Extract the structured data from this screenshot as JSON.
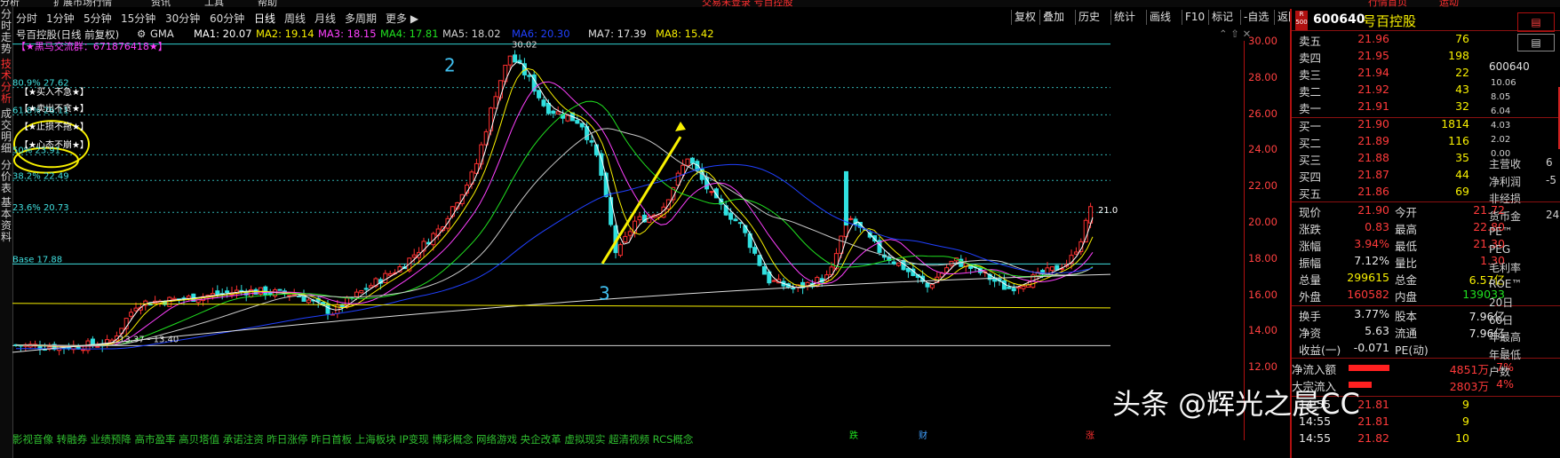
{
  "menu": {
    "items": [
      "分析",
      "扩展市场行情",
      "资讯",
      "工具",
      "帮助"
    ],
    "title_center": "交易未登录 号百控股",
    "right_items": [
      "行情首页",
      "运动"
    ]
  },
  "side_tabs": [
    {
      "label": "分时走势",
      "active": false
    },
    {
      "label": "技术分析",
      "active": true
    },
    {
      "label": "成交明细",
      "active": false
    },
    {
      "label": "分价表",
      "active": false
    },
    {
      "label": "基本资料",
      "active": false
    }
  ],
  "periods": [
    "分时",
    "1分钟",
    "5分钟",
    "15分钟",
    "30分钟",
    "60分钟",
    "日线",
    "周线",
    "月线",
    "多周期",
    "更多 ▶"
  ],
  "active_period": "日线",
  "toolbar": [
    "复权",
    "叠加",
    "历史",
    "统计",
    "画线",
    "F10",
    "标记",
    "-自选",
    "返回"
  ],
  "chart_header": {
    "stock": "号百控股(日线 前复权)",
    "indicator": "GMA"
  },
  "ma_labels": [
    {
      "text": "MA1: 20.07",
      "color": "#ffffff"
    },
    {
      "text": "MA2: 19.14",
      "color": "#f8f000"
    },
    {
      "text": "MA3: 18.15",
      "color": "#ff40ff"
    },
    {
      "text": "MA4: 17.81",
      "color": "#20e020"
    },
    {
      "text": "MA5: 18.02",
      "color": "#d0d0d0"
    },
    {
      "text": "MA6: 20.30",
      "color": "#2040ff"
    },
    {
      "text": "MA7: 17.39",
      "color": "#e0e0e0"
    },
    {
      "text": "MA8: 15.42",
      "color": "#f8f000"
    }
  ],
  "price_ticks": [
    "30.00",
    "28.00",
    "26.00",
    "24.00",
    "22.00",
    "20.00",
    "18.00",
    "16.00",
    "14.00",
    "12.00"
  ],
  "annotations": {
    "group": "【★黑马交流群：671876418★】",
    "fib_80": "80.9% 27.62",
    "fib_618": "61.8% 26.11",
    "fib_50": "50% 23.91",
    "fib_382": "38.2% 22.49",
    "fib_236": "23.6% 20.73",
    "base": "Base 17.88",
    "slogans": [
      "【★买入不急★】",
      "【★卖出不贪★】",
      "【★止损不拖★】",
      "【★心态不崩★】"
    ],
    "peak": "30.02",
    "low": "13.37 - 13.40",
    "wave2": "2",
    "wave3": "3",
    "last_price_tag": "21.0",
    "bottom_ticks": [
      "跌",
      "财",
      "涨"
    ]
  },
  "concepts": "影视音像 转融券 业绩预降 高市盈率 高贝塔值 承诺注资 昨日涨停 昨日首板 上海板块 IP变现 博彩概念 网络游戏 央企改革 虚拟现实 超清视频 RCS概念",
  "quote": {
    "code": "600640",
    "name": "号百控股",
    "badge": "R 500",
    "asks": [
      {
        "label": "卖五",
        "price": "21.96",
        "vol": "76"
      },
      {
        "label": "卖四",
        "price": "21.95",
        "vol": "198"
      },
      {
        "label": "卖三",
        "price": "21.94",
        "vol": "22"
      },
      {
        "label": "卖二",
        "price": "21.92",
        "vol": "43"
      },
      {
        "label": "卖一",
        "price": "21.91",
        "vol": "32"
      }
    ],
    "bids": [
      {
        "label": "买一",
        "price": "21.90",
        "vol": "1814"
      },
      {
        "label": "买二",
        "price": "21.89",
        "vol": "116"
      },
      {
        "label": "买三",
        "price": "21.88",
        "vol": "35"
      },
      {
        "label": "买四",
        "price": "21.87",
        "vol": "44"
      },
      {
        "label": "买五",
        "price": "21.86",
        "vol": "69"
      }
    ],
    "stats": [
      {
        "l1": "现价",
        "v1": "21.90",
        "c1": "red",
        "l2": "今开",
        "v2": "21.72",
        "c2": "red"
      },
      {
        "l1": "涨跌",
        "v1": "0.83",
        "c1": "red",
        "l2": "最高",
        "v2": "22.80",
        "c2": "red"
      },
      {
        "l1": "涨幅",
        "v1": "3.94%",
        "c1": "red",
        "l2": "最低",
        "v2": "21.30",
        "c2": "red"
      },
      {
        "l1": "振幅",
        "v1": "7.12%",
        "c1": "white",
        "l2": "量比",
        "v2": "1.30",
        "c2": "red"
      },
      {
        "l1": "总量",
        "v1": "299615",
        "c1": "yellow",
        "l2": "总金",
        "v2": "6.57亿",
        "c2": "yellow"
      },
      {
        "l1": "外盘",
        "v1": "160582",
        "c1": "red",
        "l2": "内盘",
        "v2": "139033",
        "c2": "green"
      }
    ],
    "stats2": [
      {
        "l1": "换手",
        "v1": "3.77%",
        "c1": "white",
        "l2": "股本",
        "v2": "7.96亿",
        "c2": "white"
      },
      {
        "l1": "净资",
        "v1": "5.63",
        "c1": "white",
        "l2": "流通",
        "v2": "7.96亿",
        "c2": "white"
      },
      {
        "l1": "收益(一)",
        "v1": "-0.071",
        "c1": "white",
        "l2": "PE(动)",
        "v2": "-",
        "c2": "white"
      }
    ],
    "flows": [
      {
        "label": "净流入额",
        "value": "4851万",
        "pct": "7%",
        "bar": 0.7
      },
      {
        "label": "大宗流入",
        "value": "2803万",
        "pct": "4%",
        "bar": 0.4
      }
    ],
    "ticks": [
      {
        "time": "14:55",
        "price": "21.81",
        "vol": "9"
      },
      {
        "time": "14:55",
        "price": "21.81",
        "vol": "9"
      },
      {
        "time": "14:55",
        "price": "21.82",
        "vol": "10"
      }
    ]
  },
  "right_panel": {
    "code": "600640",
    "axis": [
      "10.06",
      "8.05",
      "6.04",
      "4.03",
      "2.02",
      "0.00"
    ],
    "labels": [
      "主营收",
      "净利润",
      "非经损",
      "货币金",
      "PE™",
      "PEG",
      "毛利率",
      "ROE™",
      "20日",
      "60日",
      "年最高",
      "年最低",
      "户数"
    ],
    "values": [
      "6",
      "-5",
      "",
      "24",
      "",
      "",
      "",
      "",
      "",
      "",
      "",
      "",
      ""
    ]
  },
  "watermark": "头条 @辉光之晨CC"
}
